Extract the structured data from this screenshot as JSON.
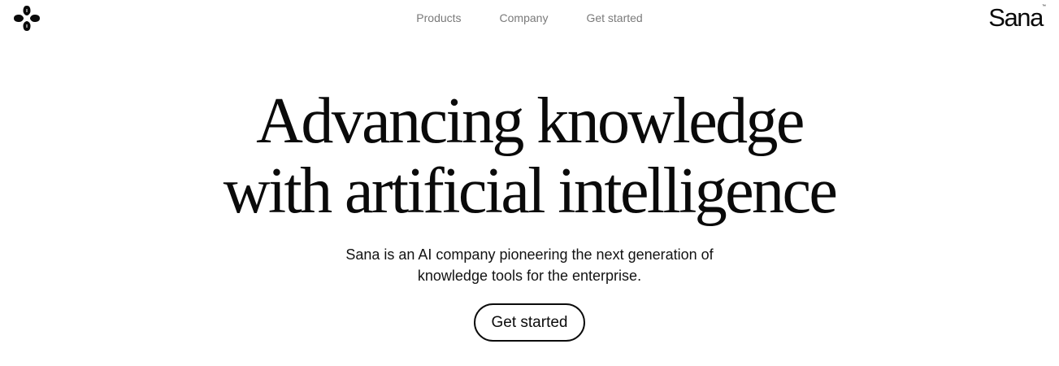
{
  "brand": {
    "logo_icon": "four-petal-logo-icon",
    "wordmark": "Sana",
    "trademark": "™"
  },
  "nav": {
    "items": [
      {
        "label": "Products"
      },
      {
        "label": "Company"
      },
      {
        "label": "Get started"
      }
    ]
  },
  "hero": {
    "title_lines": [
      "Advancing knowledge",
      "with artificial intelligence"
    ],
    "subtitle_lines": [
      "Sana is an AI company pioneering the next generation of",
      "knowledge tools for the enterprise."
    ],
    "cta_label": "Get started"
  },
  "colors": {
    "text": "#0a0a0a",
    "nav_text": "#7a7a7a",
    "background": "#ffffff"
  }
}
